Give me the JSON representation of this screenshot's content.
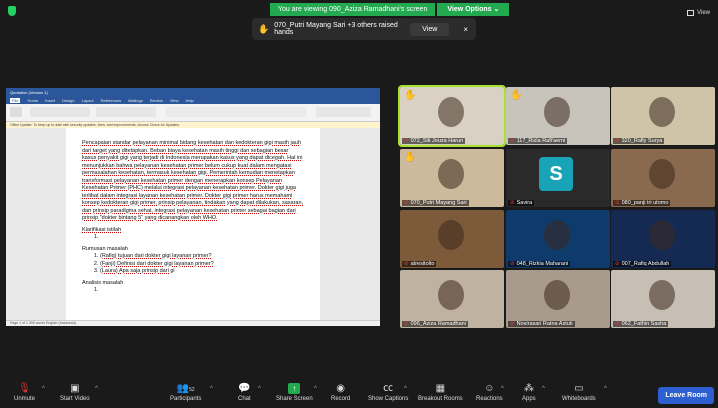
{
  "banner": {
    "message": "You are viewing 090_Aziza Ramadhani's screen",
    "view_options": "View Options"
  },
  "top_view_label": "View",
  "raised_hands": {
    "text": "070_Putri Mayang Sari +3 others raised hands",
    "view_button": "View",
    "close": "×"
  },
  "word": {
    "title_text": "Quotation (Version 1)",
    "tabs": [
      "File",
      "Home",
      "Insert",
      "Design",
      "Layout",
      "References",
      "Mailings",
      "Review",
      "View",
      "Help"
    ],
    "info_bar": "Office Update: To keep up to date with security updates, fixes, and improvements, choose Check for Updates.",
    "paragraph": "Pencapaian standar pelayanan minimal bidang kesehatan dan kedokteran gigi masih jauh dari target yang ditetapkan. Beban biaya kesehatan masih tinggi dan sebagian besar kasus penyakit gigi yang terjadi di Indonesia merupakan kasus yang dapat dicegah. Hal ini menunjukkan bahwa pelayanan kesehatan primer belum cukup kuat dalam mengatasi permasalahan kesehatan, termasuk kesehatan gigi. Pemerintah kemudian menetapkan transformasi pelayanan kesehatan primer dengan menerapkan konsep Pelayanan Kesehatan Primer (PHC) melalui integrasi pelayanan kesehatan primer. Dokter gigi juga terlibat dalam integrasi layanan kesehatan primer. Dokter gigi primer harus memahami konsep kedokteran gigi primer, prinsip pelayanan, tindakan yang dapat dilakukan, sasaran, dan prinsip paradigma sehat, integrasi pelayanan kesehatan primer sebagai bagian dari prinsip \"dokter bintang 5\" yang dicanangkan oleh WHO.",
    "klarifikasi_heading": "Klarifikasi istilah",
    "klarifikasi_items": [
      ""
    ],
    "rumusan_heading": "Rumusan masalah",
    "rumusan_items": [
      "(Rafiq) tujuan dari dokter gigi layanan primer?",
      "(Fanji) Definisi dari dokter gigi layanan primer?",
      "(Laura) Apa saja prinsip dari gi"
    ],
    "analisis_heading": "Analisis masalah",
    "analisis_items": [
      ""
    ],
    "status": "Page 1 of 1   305 words   English (Indonesia)"
  },
  "participants": [
    {
      "name": "072_Siti Jouza Harun",
      "hand": true,
      "bg": "#d9d2c4",
      "active": true
    },
    {
      "name": "117_Rizla Rafi'aerni",
      "hand": true,
      "bg": "#c8c3bb"
    },
    {
      "name": "320_Rafly Surya",
      "hand": false,
      "bg": "#cfc4a8"
    },
    {
      "name": "070_Putri Mayang Sari",
      "hand": true,
      "bg": "#cdb99b"
    },
    {
      "name": "Savira",
      "hand": false,
      "bg": "#2a2a2a",
      "initial": "S"
    },
    {
      "name": "080_panji tri utomo",
      "hand": false,
      "bg": "#8a6a4e"
    },
    {
      "name": "atresitolto",
      "hand": false,
      "bg": "#7c5a3a"
    },
    {
      "name": "048_Rizkia Maharani",
      "hand": false,
      "bg": "#0e3b6b"
    },
    {
      "name": "007_Rafiq Abdullah",
      "hand": false,
      "bg": "#152a52"
    },
    {
      "name": "096_Aziza Ramadhani",
      "hand": false,
      "bg": "#bfb2a1"
    },
    {
      "name": "Novirasari Ratna Astuti",
      "hand": false,
      "bg": "#a99a8e"
    },
    {
      "name": "062_Fathin Sasha",
      "hand": false,
      "bg": "#c7beb4"
    }
  ],
  "toolbar": {
    "unmute": "Unmute",
    "start_video": "Start Video",
    "participants": "Participants",
    "participants_count": "52",
    "chat": "Chat",
    "share_screen": "Share Screen",
    "record": "Record",
    "show_captions": "Show Captions",
    "breakout_rooms": "Breakout Rooms",
    "reactions": "Reactions",
    "apps": "Apps",
    "whiteboards": "Whiteboards",
    "leave": "Leave Room"
  },
  "colors": {
    "share_green": "#23a94f",
    "leave_blue": "#2d5fd0",
    "hand_yellow": "#f5b800"
  }
}
